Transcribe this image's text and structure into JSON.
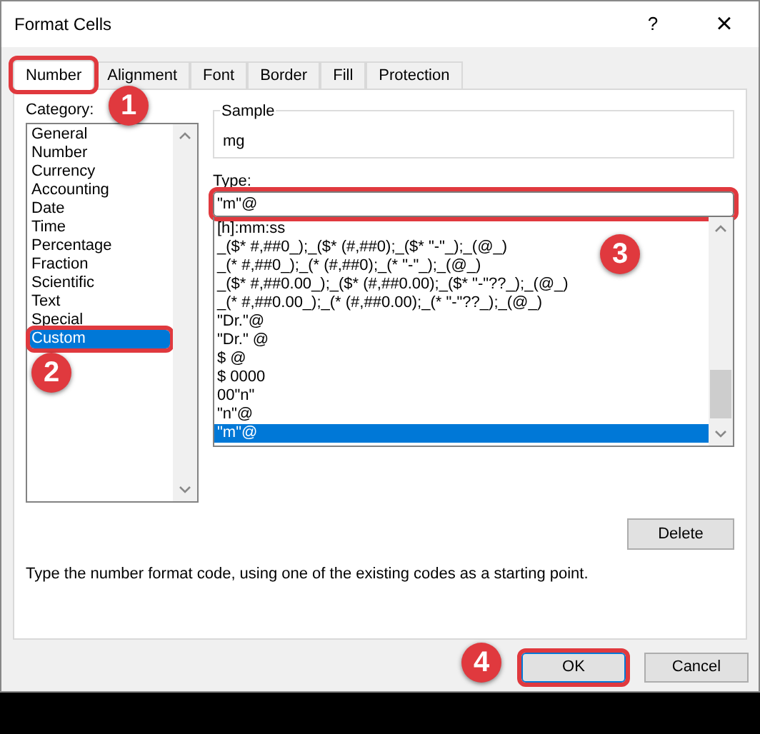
{
  "window": {
    "title": "Format Cells",
    "help": "?",
    "close": "×"
  },
  "tabs": [
    {
      "label": "Number",
      "selected": true,
      "highlighted": true
    },
    {
      "label": "Alignment",
      "selected": false,
      "highlighted": false
    },
    {
      "label": "Font",
      "selected": false,
      "highlighted": false
    },
    {
      "label": "Border",
      "selected": false,
      "highlighted": false
    },
    {
      "label": "Fill",
      "selected": false,
      "highlighted": false
    },
    {
      "label": "Protection",
      "selected": false,
      "highlighted": false
    }
  ],
  "category": {
    "label": "Category:",
    "items": [
      {
        "label": "General",
        "selected": false,
        "highlighted": false
      },
      {
        "label": "Number",
        "selected": false,
        "highlighted": false
      },
      {
        "label": "Currency",
        "selected": false,
        "highlighted": false
      },
      {
        "label": "Accounting",
        "selected": false,
        "highlighted": false
      },
      {
        "label": "Date",
        "selected": false,
        "highlighted": false
      },
      {
        "label": "Time",
        "selected": false,
        "highlighted": false
      },
      {
        "label": "Percentage",
        "selected": false,
        "highlighted": false
      },
      {
        "label": "Fraction",
        "selected": false,
        "highlighted": false
      },
      {
        "label": "Scientific",
        "selected": false,
        "highlighted": false
      },
      {
        "label": "Text",
        "selected": false,
        "highlighted": false
      },
      {
        "label": "Special",
        "selected": false,
        "highlighted": false
      },
      {
        "label": "Custom",
        "selected": true,
        "highlighted": true
      }
    ]
  },
  "sample": {
    "label": "Sample",
    "value": "mg"
  },
  "type": {
    "label": "Type:",
    "value": "\"m\"@",
    "highlighted": true,
    "formats": [
      {
        "label": "[h]:mm:ss",
        "selected": false
      },
      {
        "label": "_($* #,##0_);_($* (#,##0);_($* \"-\"_);_(@_)",
        "selected": false
      },
      {
        "label": "_(* #,##0_);_(* (#,##0);_(* \"-\"_);_(@_)",
        "selected": false
      },
      {
        "label": "_($* #,##0.00_);_($* (#,##0.00);_($* \"-\"??_);_(@_)",
        "selected": false
      },
      {
        "label": "_(* #,##0.00_);_(* (#,##0.00);_(* \"-\"??_);_(@_)",
        "selected": false
      },
      {
        "label": "\"Dr.\"@",
        "selected": false
      },
      {
        "label": "\"Dr.\" @",
        "selected": false
      },
      {
        "label": "$ @",
        "selected": false
      },
      {
        "label": "$ 0000",
        "selected": false
      },
      {
        "label": "00\"n\"",
        "selected": false
      },
      {
        "label": "\"n\"@",
        "selected": false
      },
      {
        "label": "\"m\"@",
        "selected": true
      }
    ]
  },
  "delete_button": {
    "label": "Delete",
    "highlighted": false
  },
  "description": "Type the number format code, using one of the existing codes as a starting point.",
  "buttons": [
    {
      "label": "OK",
      "highlighted": true
    },
    {
      "label": "Cancel",
      "highlighted": false
    }
  ],
  "callouts": [
    {
      "label": "1"
    },
    {
      "label": "2"
    },
    {
      "label": "3"
    },
    {
      "label": "4"
    }
  ]
}
